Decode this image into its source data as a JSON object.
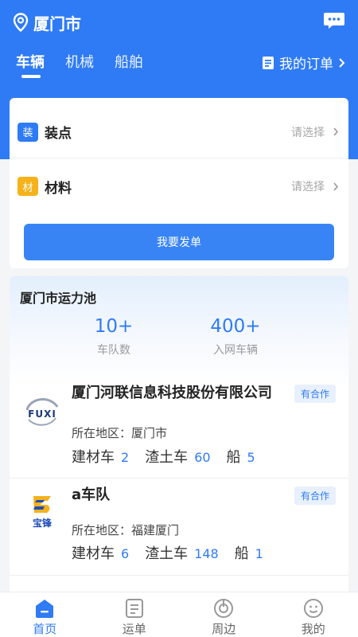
{
  "header": {
    "city": "厦门市",
    "tabs": [
      {
        "label": "车辆",
        "active": true
      },
      {
        "label": "机械",
        "active": false
      },
      {
        "label": "船舶",
        "active": false
      }
    ],
    "my_orders": "我的订单"
  },
  "order_form": {
    "load_point": {
      "badge": "装",
      "label": "装点",
      "hint": "请选择"
    },
    "material": {
      "badge": "材",
      "label": "材料",
      "hint": "请选择"
    },
    "submit": "我要发单"
  },
  "pool": {
    "title": "厦门市运力池",
    "stats": [
      {
        "value": "10+",
        "label": "车队数"
      },
      {
        "value": "400+",
        "label": "入网车辆"
      }
    ],
    "companies": [
      {
        "logo": "FUXI",
        "name": "厦门河联信息科技股份有限公司",
        "tag": "有合作",
        "region": "所在地区：厦门市",
        "counts": [
          {
            "label": "建材车",
            "value": "2"
          },
          {
            "label": "渣土车",
            "value": "60"
          },
          {
            "label": "船",
            "value": "5"
          }
        ]
      },
      {
        "logo": "宝锋",
        "name": "a车队",
        "tag": "有合作",
        "region": "所在地区：福建厦门",
        "counts": [
          {
            "label": "建材车",
            "value": "6"
          },
          {
            "label": "渣土车",
            "value": "148"
          },
          {
            "label": "船",
            "value": "1"
          }
        ]
      }
    ]
  },
  "tabbar": {
    "items": [
      {
        "label": "首页",
        "icon": "home-icon",
        "active": true
      },
      {
        "label": "运单",
        "icon": "waybill-icon",
        "active": false
      },
      {
        "label": "周边",
        "icon": "nearby-icon",
        "active": false
      },
      {
        "label": "我的",
        "icon": "profile-icon",
        "active": false
      }
    ]
  },
  "colors": {
    "accent": "#2f7bf5",
    "badge_yellow": "#f5b21b",
    "hint": "#a6a6a6"
  }
}
